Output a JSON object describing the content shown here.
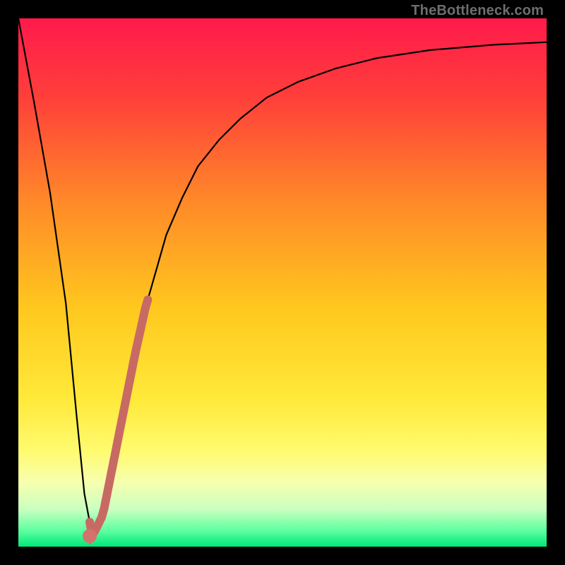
{
  "watermark": {
    "text": "TheBottleneck.com"
  },
  "colors": {
    "frame": "#000000",
    "gradient_stops": [
      {
        "offset": 0.0,
        "color": "#ff1a4b"
      },
      {
        "offset": 0.15,
        "color": "#ff3f3a"
      },
      {
        "offset": 0.35,
        "color": "#ff8a28"
      },
      {
        "offset": 0.55,
        "color": "#ffc81e"
      },
      {
        "offset": 0.72,
        "color": "#ffe93a"
      },
      {
        "offset": 0.82,
        "color": "#fffb70"
      },
      {
        "offset": 0.88,
        "color": "#f6ffb0"
      },
      {
        "offset": 0.93,
        "color": "#c9ffc0"
      },
      {
        "offset": 0.97,
        "color": "#5cffa0"
      },
      {
        "offset": 1.0,
        "color": "#00e77a"
      }
    ],
    "curve": "#000000",
    "highlight": "#c86a64",
    "highlight_end": "#d4736b"
  },
  "chart_data": {
    "type": "line",
    "title": "",
    "xlabel": "",
    "ylabel": "",
    "x_range": [
      0,
      100
    ],
    "y_range": [
      0,
      100
    ],
    "grid": false,
    "legend": false,
    "series": [
      {
        "name": "bottleneck-curve",
        "x": [
          0,
          3,
          6,
          9,
          11,
          12.5,
          14,
          16,
          18,
          20,
          22,
          24,
          26,
          28,
          31,
          34,
          38,
          42,
          47,
          53,
          60,
          68,
          78,
          90,
          100
        ],
        "y": [
          100,
          84,
          67,
          46,
          25,
          10,
          2,
          6,
          16,
          26,
          36,
          45,
          52,
          59,
          66,
          72,
          77,
          81,
          85,
          88,
          90.5,
          92.5,
          94,
          95,
          95.5
        ]
      }
    ],
    "highlight_segment": {
      "series": "bottleneck-curve",
      "x_start": 13.5,
      "x_end": 24.5,
      "note": "thick red overlay on rising limb"
    },
    "valley_marker": {
      "x": 13.5,
      "y": 2
    }
  }
}
